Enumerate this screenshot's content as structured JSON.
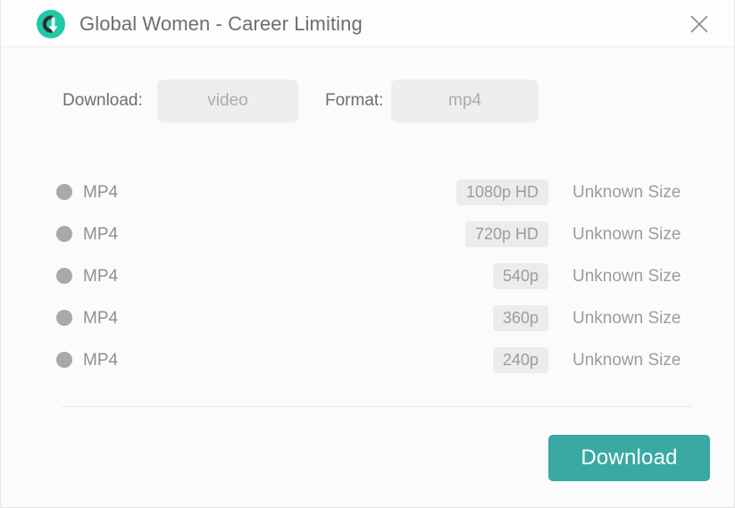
{
  "window": {
    "title": "Global Women - Career Limiting",
    "app_icon": "download-circle-icon",
    "close_icon": "close-icon",
    "accent_color": "#3aa9a4",
    "background_color": "#fbfbfc"
  },
  "selectors": {
    "download": {
      "label": "Download:",
      "value": "video",
      "icon": "media-type-select"
    },
    "format": {
      "label": "Format:",
      "value": "mp4",
      "icon": "format-select"
    }
  },
  "quality_list": {
    "rows": [
      {
        "format": "MP4",
        "quality": "1080p HD",
        "size": "Unknown Size",
        "selected": false
      },
      {
        "format": "MP4",
        "quality": "720p HD",
        "size": "Unknown Size",
        "selected": false
      },
      {
        "format": "MP4",
        "quality": "540p",
        "size": "Unknown Size",
        "selected": false
      },
      {
        "format": "MP4",
        "quality": "360p",
        "size": "Unknown Size",
        "selected": false
      },
      {
        "format": "MP4",
        "quality": "240p",
        "size": "Unknown Size",
        "selected": false
      }
    ]
  },
  "footer": {
    "download_button_label": "Download"
  }
}
